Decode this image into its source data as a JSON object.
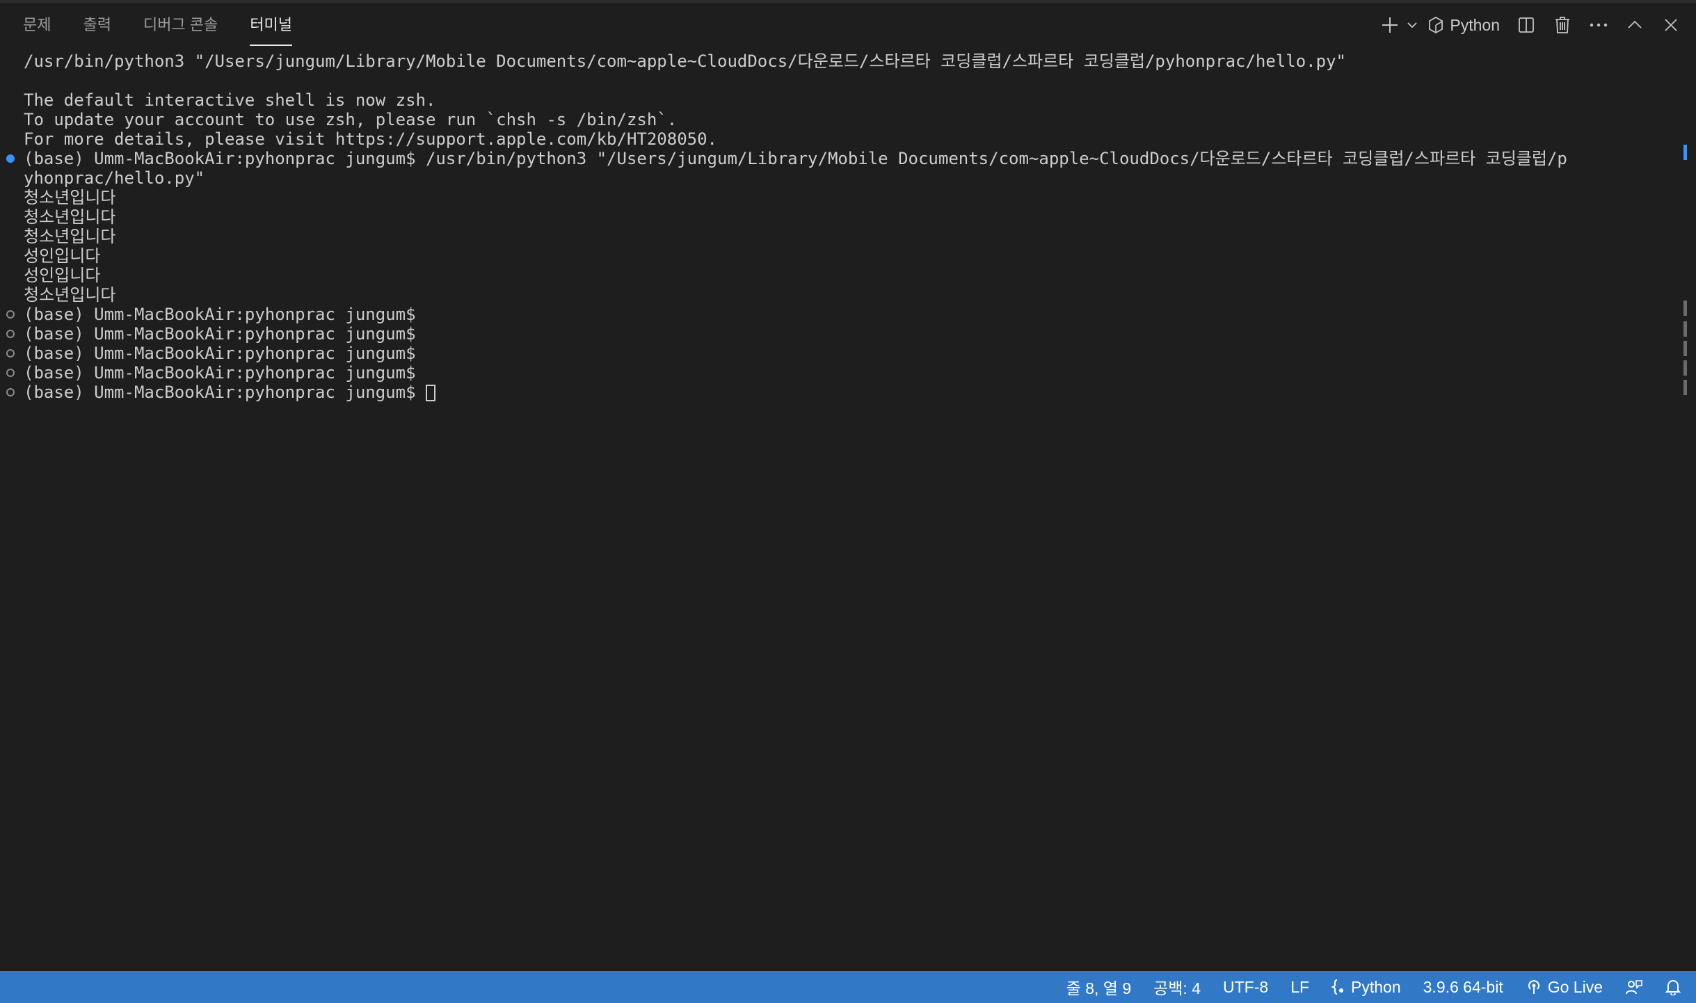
{
  "panel": {
    "tabs": [
      {
        "label": "문제",
        "active": false
      },
      {
        "label": "출력",
        "active": false
      },
      {
        "label": "디버그 콘솔",
        "active": false
      },
      {
        "label": "터미널",
        "active": true
      }
    ],
    "actions": {
      "new_terminal_icon": "plus-icon",
      "dropdown_icon": "chevron-down-icon",
      "shell_name": "Python",
      "split_icon": "split-icon",
      "kill_icon": "trash-icon",
      "more_icon": "ellipsis-icon",
      "maximize_icon": "chevron-up-icon",
      "close_icon": "close-icon"
    }
  },
  "terminal": {
    "lines": [
      {
        "text": "/usr/bin/python3 \"/Users/jungum/Library/Mobile Documents/com~apple~CloudDocs/다운로드/스타르타 코딩클럽/스파르타 코딩클럽/pyhonprac/hello.py\"",
        "decoration": "none"
      },
      {
        "text": "",
        "decoration": "none"
      },
      {
        "text": "The default interactive shell is now zsh.",
        "decoration": "none"
      },
      {
        "text": "To update your account to use zsh, please run `chsh -s /bin/zsh`.",
        "decoration": "none"
      },
      {
        "text": "For more details, please visit https://support.apple.com/kb/HT208050.",
        "decoration": "none"
      },
      {
        "text": "(base) Umm-MacBookAir:pyhonprac jungum$ /usr/bin/python3 \"/Users/jungum/Library/Mobile Documents/com~apple~CloudDocs/다운로드/스타르타 코딩클럽/스파르타 코딩클럽/p",
        "decoration": "success"
      },
      {
        "text": "yhonprac/hello.py\"",
        "decoration": "none"
      },
      {
        "text": "청소년입니다",
        "decoration": "none"
      },
      {
        "text": "청소년입니다",
        "decoration": "none"
      },
      {
        "text": "청소년입니다",
        "decoration": "none"
      },
      {
        "text": "성인입니다",
        "decoration": "none"
      },
      {
        "text": "성인입니다",
        "decoration": "none"
      },
      {
        "text": "청소년입니다",
        "decoration": "none"
      },
      {
        "text": "(base) Umm-MacBookAir:pyhonprac jungum$",
        "decoration": "default"
      },
      {
        "text": "(base) Umm-MacBookAir:pyhonprac jungum$",
        "decoration": "default"
      },
      {
        "text": "(base) Umm-MacBookAir:pyhonprac jungum$",
        "decoration": "default"
      },
      {
        "text": "(base) Umm-MacBookAir:pyhonprac jungum$",
        "decoration": "default"
      },
      {
        "text": "(base) Umm-MacBookAir:pyhonprac jungum$",
        "decoration": "default",
        "cursor": true
      }
    ]
  },
  "statusbar": {
    "position": "줄 8, 열 9",
    "indent": "공백: 4",
    "encoding": "UTF-8",
    "eol": "LF",
    "language": "Python",
    "language_icon": "braces-icon",
    "interpreter": "3.9.6 64-bit",
    "go_live": "Go Live",
    "go_live_icon": "broadcast-icon",
    "feedback_icon": "feedback-icon",
    "notifications_icon": "bell-icon"
  },
  "colors": {
    "background": "#1e1e1e",
    "statusbar": "#3178c6",
    "accent_blue": "#3794ff",
    "text": "#cccccc"
  }
}
